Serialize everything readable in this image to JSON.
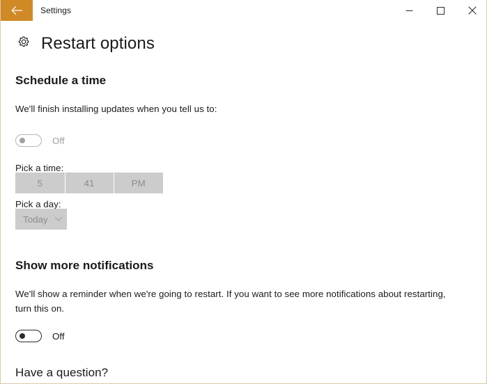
{
  "window": {
    "title": "Settings",
    "back_icon": "back-arrow-icon",
    "controls": {
      "minimize": "minimize-icon",
      "maximize": "maximize-icon",
      "close": "close-icon"
    },
    "accent_color": "#cf8a26",
    "border_color": "#d9c9a8"
  },
  "page": {
    "icon": "gear-icon",
    "title": "Restart options"
  },
  "schedule_section": {
    "heading": "Schedule a time",
    "description": "We'll finish installing updates when you tell us to:",
    "toggle": {
      "state": "Off",
      "enabled": false
    },
    "pick_time": {
      "label": "Pick a time:",
      "hour": "5",
      "minute": "41",
      "period": "PM",
      "enabled": false
    },
    "pick_day": {
      "label": "Pick a day:",
      "value": "Today",
      "chevron": "chevron-down-icon",
      "enabled": false
    }
  },
  "notifications_section": {
    "heading": "Show more notifications",
    "description": "We'll show a reminder when we're going to restart. If you want to see more notifications about restarting, turn this on.",
    "toggle": {
      "state": "Off",
      "enabled": true
    }
  },
  "question_section": {
    "heading": "Have a question?"
  }
}
